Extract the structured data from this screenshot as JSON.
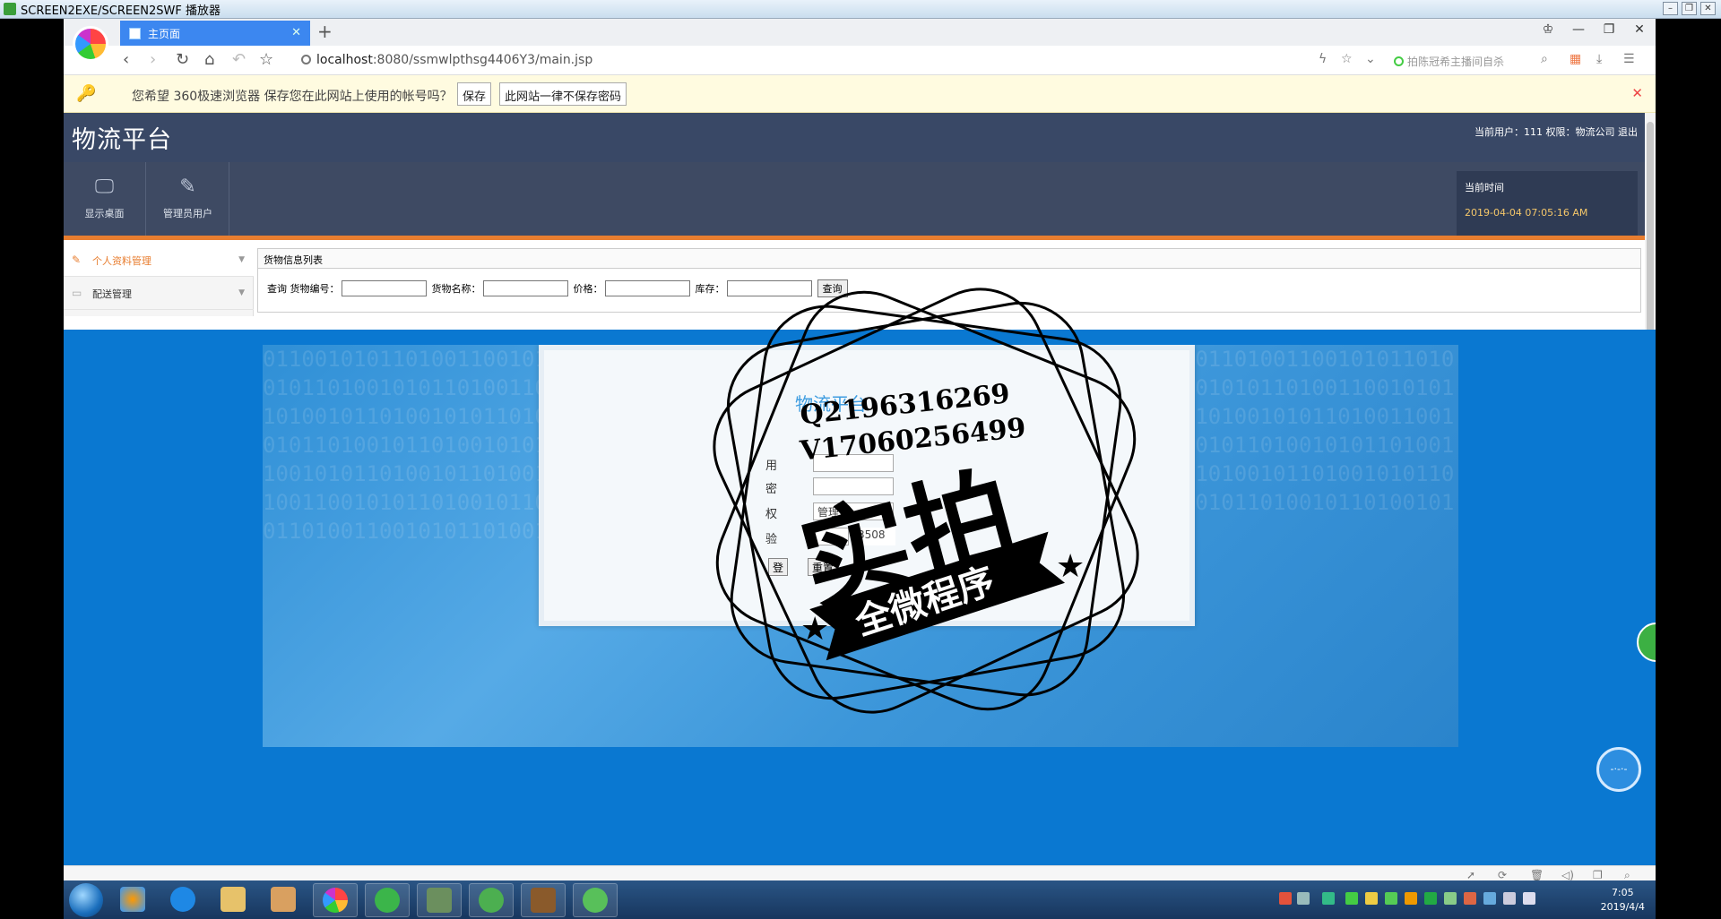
{
  "player": {
    "title": "SCREEN2EXE/SCREEN2SWF 播放器"
  },
  "browser": {
    "tab_title": "主页面",
    "url_host": "localhost",
    "url_rest": ":8080/ssmwlpthsg4406Y3/main.jsp",
    "search_hint": "拍陈冠希主播间自杀",
    "password_bar": {
      "message": "您希望 360极速浏览器 保存您在此网站上使用的帐号吗？",
      "save_label": "保存",
      "never_label": "此网站一律不保存密码"
    }
  },
  "site": {
    "title": "物流平台",
    "user_info": "当前用户：111  权限：物流公司  退出",
    "nav": [
      {
        "label": "显示桌面",
        "icon": "monitor-icon"
      },
      {
        "label": "管理员用户",
        "icon": "pencil-icon"
      }
    ],
    "time_label": "当前时间",
    "time_value": "2019-04-04 07:05:16 AM",
    "sidebar": [
      {
        "label": "个人资料管理",
        "active": true
      },
      {
        "label": "配送管理",
        "active": false
      }
    ],
    "content_title": "货物信息列表",
    "filter": {
      "prefix": "查询",
      "code_label": "货物编号：",
      "name_label": "货物名称：",
      "price_label": "价格：",
      "stock_label": "库存：",
      "query_button": "查询"
    }
  },
  "login_modal": {
    "title": "物流平台",
    "user_label": "用",
    "pass_label": "密",
    "role_label": "权",
    "code_label": "验",
    "role_value": "管理员",
    "captcha_value": "3508",
    "login_button": "登",
    "reset_button": "重置"
  },
  "watermark": {
    "qq": "Q2196316269",
    "wechat": "V17060256499",
    "big_text": "实拍",
    "banner_text": "全微程序"
  },
  "taskbar": {
    "clock_time": "7:05",
    "clock_date": "2019/4/4"
  },
  "colors": {
    "header_dark": "#394866",
    "accent_orange": "#e87e30",
    "overlay_blue": "#0a78d1",
    "tab_blue": "#3c87f0"
  }
}
